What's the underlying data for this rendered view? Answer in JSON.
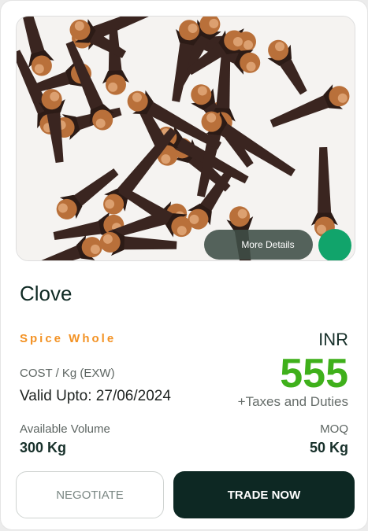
{
  "product": {
    "name": "Clove",
    "category": "Spice Whole",
    "image_label": "clove-product-image"
  },
  "image_overlay": {
    "more_details_label": "More Details",
    "dot_color": "#11a46b"
  },
  "pricing": {
    "currency": "INR",
    "price": "555",
    "taxes_note": "+Taxes and Duties",
    "cost_label": "COST / Kg (EXW)",
    "valid_upto": "Valid Upto: 27/06/2024"
  },
  "volume": {
    "available_label": "Available Volume",
    "available_value": "300 Kg",
    "moq_label": "MOQ",
    "moq_value": "50 Kg"
  },
  "actions": {
    "negotiate_label": "NEGOTIATE",
    "trade_label": "TRADE NOW"
  },
  "colors": {
    "accent_orange": "#f39224",
    "price_green": "#3fb01b",
    "dark_button": "#0d2823"
  }
}
